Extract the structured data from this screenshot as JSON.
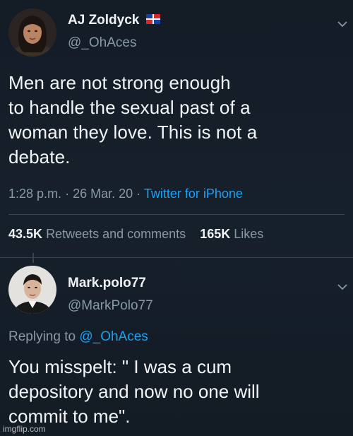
{
  "tweet": {
    "display_name": "AJ Zoldyck",
    "handle": "@_OhAces",
    "flag_icon": "dominican-republic-flag-icon",
    "text_lines": [
      "Men are not strong enough",
      "to handle the sexual past of a",
      "woman they love. This is not a",
      "debate."
    ],
    "time": "1:28 p.m.",
    "date": "26 Mar. 20",
    "source": "Twitter for iPhone",
    "retweets_count": "43.5K",
    "retweets_label": "Retweets and comments",
    "likes_count": "165K",
    "likes_label": "Likes"
  },
  "reply": {
    "display_name": "Mark.polo77",
    "handle": "@MarkPolo77",
    "replying_prefix": "Replying to",
    "replying_mention": "@_OhAces",
    "text_lines": [
      "You misspelt: \" I was a cum",
      "depository and now no one will",
      "commit to me\"."
    ]
  },
  "watermark": "imgflip.com",
  "colors": {
    "background": "#15202b",
    "link": "#1da1f2",
    "muted": "#8899a6",
    "divider": "#38444d"
  }
}
